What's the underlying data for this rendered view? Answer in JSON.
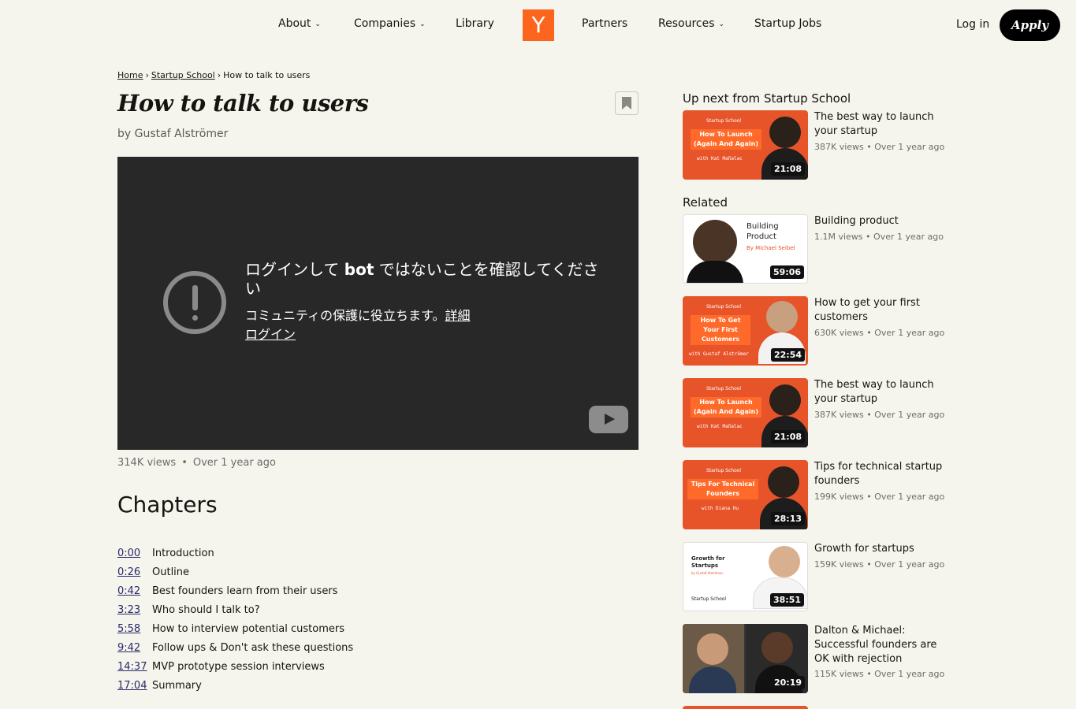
{
  "nav": {
    "about": "About",
    "companies": "Companies",
    "library": "Library",
    "logo": "Y",
    "partners": "Partners",
    "resources": "Resources",
    "jobs": "Startup Jobs",
    "login": "Log in",
    "apply": "Apply"
  },
  "breadcrumb": {
    "home": "Home",
    "school": "Startup School",
    "current": "How to talk to users",
    "separator": "›"
  },
  "page": {
    "title": "How to talk to users",
    "byline": "by Gustaf Alströmer",
    "views": "314K views",
    "dot": "•",
    "age": "Over 1 year ago"
  },
  "video": {
    "msg_pre": "ログインして ",
    "msg_bot": "bot",
    "msg_post": " ではないことを確認してください",
    "sub": "コミュニティの保護に役立ちます。",
    "details_link": "詳細",
    "login_link": "ログイン"
  },
  "chapters": {
    "heading": "Chapters",
    "items": [
      {
        "ts": "0:00",
        "title": "Introduction"
      },
      {
        "ts": "0:26",
        "title": "Outline"
      },
      {
        "ts": "0:42",
        "title": "Best founders learn from their users"
      },
      {
        "ts": "3:23",
        "title": "Who should I talk to?"
      },
      {
        "ts": "5:58",
        "title": "How to interview potential customers"
      },
      {
        "ts": "9:42",
        "title": "Follow ups & Don't ask these questions"
      },
      {
        "ts": "14:37",
        "title": "MVP prototype session interviews"
      },
      {
        "ts": "17:04",
        "title": "Summary"
      }
    ]
  },
  "sidebar": {
    "up_next_heading": "Up next from Startup School",
    "related_heading": "Related",
    "up_next": {
      "title": "The best way to launch your startup",
      "meta": "387K views • Over 1 year ago",
      "duration": "21:08",
      "thumb_tag": "Startup School",
      "thumb_headline": "How To Launch (Again And Again)",
      "thumb_with": "with Kat Mañalac"
    },
    "related": [
      {
        "title": "Building product",
        "meta": "1.1M views • Over 1 year ago",
        "duration": "59:06",
        "thumb_headline": "Building Product",
        "thumb_with": "By Michael Seibel"
      },
      {
        "title": "How to get your first customers",
        "meta": "630K views • Over 1 year ago",
        "duration": "22:54",
        "thumb_tag": "Startup School",
        "thumb_headline": "How To Get Your First Customers",
        "thumb_with": "with Gustaf Alströmer"
      },
      {
        "title": "The best way to launch your startup",
        "meta": "387K views • Over 1 year ago",
        "duration": "21:08",
        "thumb_tag": "Startup School",
        "thumb_headline": "How To Launch (Again And Again)",
        "thumb_with": "with Kat Mañalac"
      },
      {
        "title": "Tips for technical startup founders",
        "meta": "199K views • Over 1 year ago",
        "duration": "28:13",
        "thumb_tag": "Startup School",
        "thumb_headline": "Tips For Technical Founders",
        "thumb_with": "with Diana Hu"
      },
      {
        "title": "Growth for startups",
        "meta": "159K views • Over 1 year ago",
        "duration": "38:51",
        "thumb_headline": "Growth for Startups",
        "thumb_with": "by Gustaf Alströmer",
        "thumb_tag": "Startup School"
      },
      {
        "title": "Dalton & Michael: Successful founders are OK with rejection",
        "meta": "115K views • Over 1 year ago",
        "duration": "20:19"
      }
    ]
  }
}
